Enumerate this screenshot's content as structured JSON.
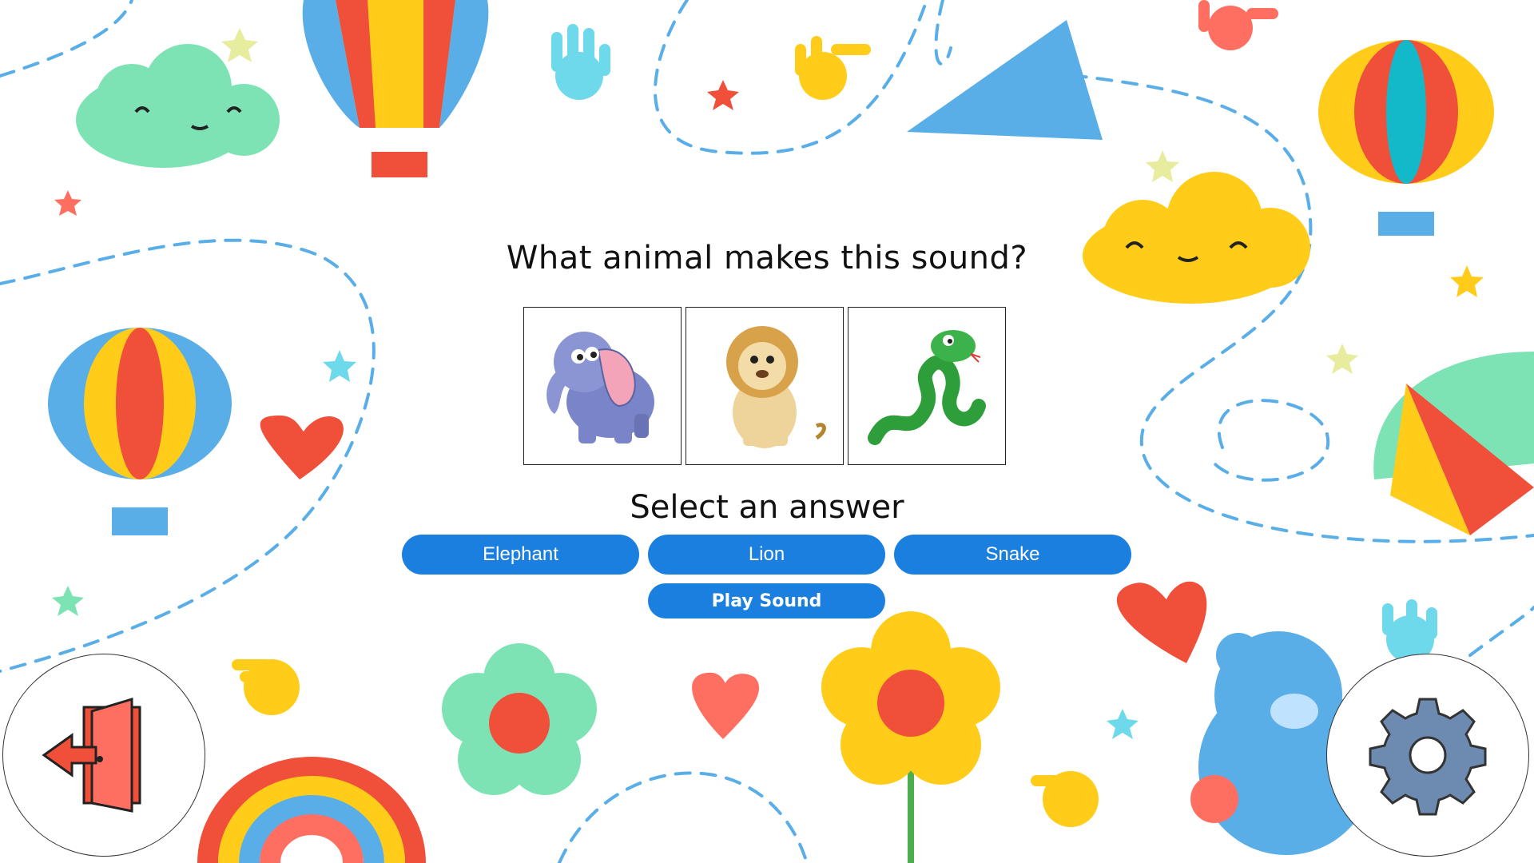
{
  "question": {
    "title": "What animal makes this sound?"
  },
  "cards": [
    {
      "animal": "elephant-illustration"
    },
    {
      "animal": "lion-illustration"
    },
    {
      "animal": "snake-illustration"
    }
  ],
  "answers": {
    "prompt": "Select an answer",
    "options": [
      "Elephant",
      "Lion",
      "Snake"
    ]
  },
  "controls": {
    "play_label": "Play Sound",
    "exit_icon": "exit-door-icon",
    "settings_icon": "gear-icon"
  },
  "colors": {
    "button": "#1b7fe0",
    "dash_line": "#5aaee8"
  }
}
